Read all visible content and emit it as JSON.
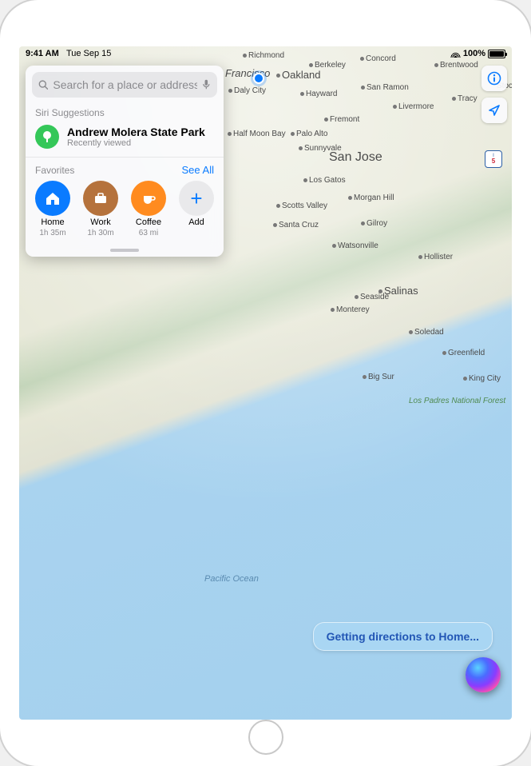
{
  "status_bar": {
    "time": "9:41 AM",
    "date": "Tue Sep 15",
    "battery_pct": "100%"
  },
  "search": {
    "placeholder": "Search for a place or address"
  },
  "siri_section_label": "Siri Suggestions",
  "suggestion": {
    "title": "Andrew Molera State Park",
    "subtitle": "Recently viewed"
  },
  "favorites_header": {
    "label": "Favorites",
    "see_all": "See All"
  },
  "favorites": [
    {
      "name": "Home",
      "meta": "1h 35m"
    },
    {
      "name": "Work",
      "meta": "1h 30m"
    },
    {
      "name": "Coffee",
      "meta": "63 mi"
    },
    {
      "name": "Add",
      "meta": ""
    }
  ],
  "siri_response": "Getting directions to Home...",
  "water_label": "Pacific\nOcean",
  "highway_label": "5",
  "forest_label": "Los Padres\nNational Forest",
  "cities": {
    "richmond": "Richmond",
    "sf": "Francisco",
    "oakland": "Oakland",
    "berkeley": "Berkeley",
    "concord": "Concord",
    "brentwood": "Brentwood",
    "dalycity": "Daly City",
    "hayward": "Hayward",
    "sanramon": "San Ramon",
    "tracy": "Tracy",
    "stockton": "Stock",
    "fremont": "Fremont",
    "livermore": "Livermore",
    "halfmoon": "Half Moon Bay",
    "paloalto": "Palo Alto",
    "sunnyvale": "Sunnyvale",
    "sanjose": "San Jose",
    "losgatos": "Los Gatos",
    "morganhill": "Morgan Hill",
    "gilroy": "Gilroy",
    "scottsvalley": "Scotts Valley",
    "santacruz": "Santa Cruz",
    "watsonville": "Watsonville",
    "hollister": "Hollister",
    "salinas": "Salinas",
    "monterey": "Monterey",
    "seaside": "Seaside",
    "soledad": "Soledad",
    "greenfield": "Greenfield",
    "bigsur": "Big Sur",
    "kingcity": "King City"
  }
}
